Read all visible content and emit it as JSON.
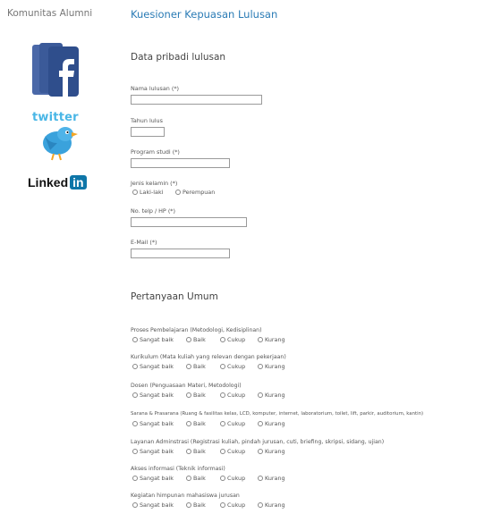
{
  "sidebar": {
    "title": "Komunitas Alumni",
    "twitter_word": "twitter",
    "linkedin_word": "Linked",
    "linkedin_in": "in"
  },
  "main": {
    "title": "Kuesioner Kepuasan Lulusan",
    "section_personal": "Data pribadi lulusan",
    "fields": [
      {
        "label": "Nama lulusan (*)",
        "value": ""
      },
      {
        "label": "Tahun lulus",
        "value": ""
      },
      {
        "label": "Program studi (*)",
        "value": ""
      },
      {
        "label": "Jenis kelamin (*)",
        "options": [
          "Laki-laki",
          "Perempuan"
        ]
      },
      {
        "label": "No. telp / HP (*)",
        "value": ""
      },
      {
        "label": "E-Mail (*)",
        "value": ""
      }
    ],
    "section_general": "Pertanyaan Umum",
    "rating_options": [
      "Sangat baik",
      "Baik",
      "Cukup",
      "Kurang"
    ],
    "questions": [
      "Proses Pembelajaran (Metodologi, Kedisiplinan)",
      "Kurikulum (Mata kuliah yang relevan dengan pekerjaan)",
      "Dosen (Penguasaan Materi, Metodologi)",
      "Sarana & Prasarana (Ruang & fasilitas kelas, LCD, komputer, internet, laboratorium, toilet, lift, parkir, auditorium, kantin)",
      "Layanan Adminstrasi (Registrasi kuliah, pindah jurusan, cuti, briefing, skripsi, sidang, ujian)",
      "Akses informasi (Teknik informasi)",
      "Kegiatan himpunan mahasiswa jurusan"
    ]
  }
}
